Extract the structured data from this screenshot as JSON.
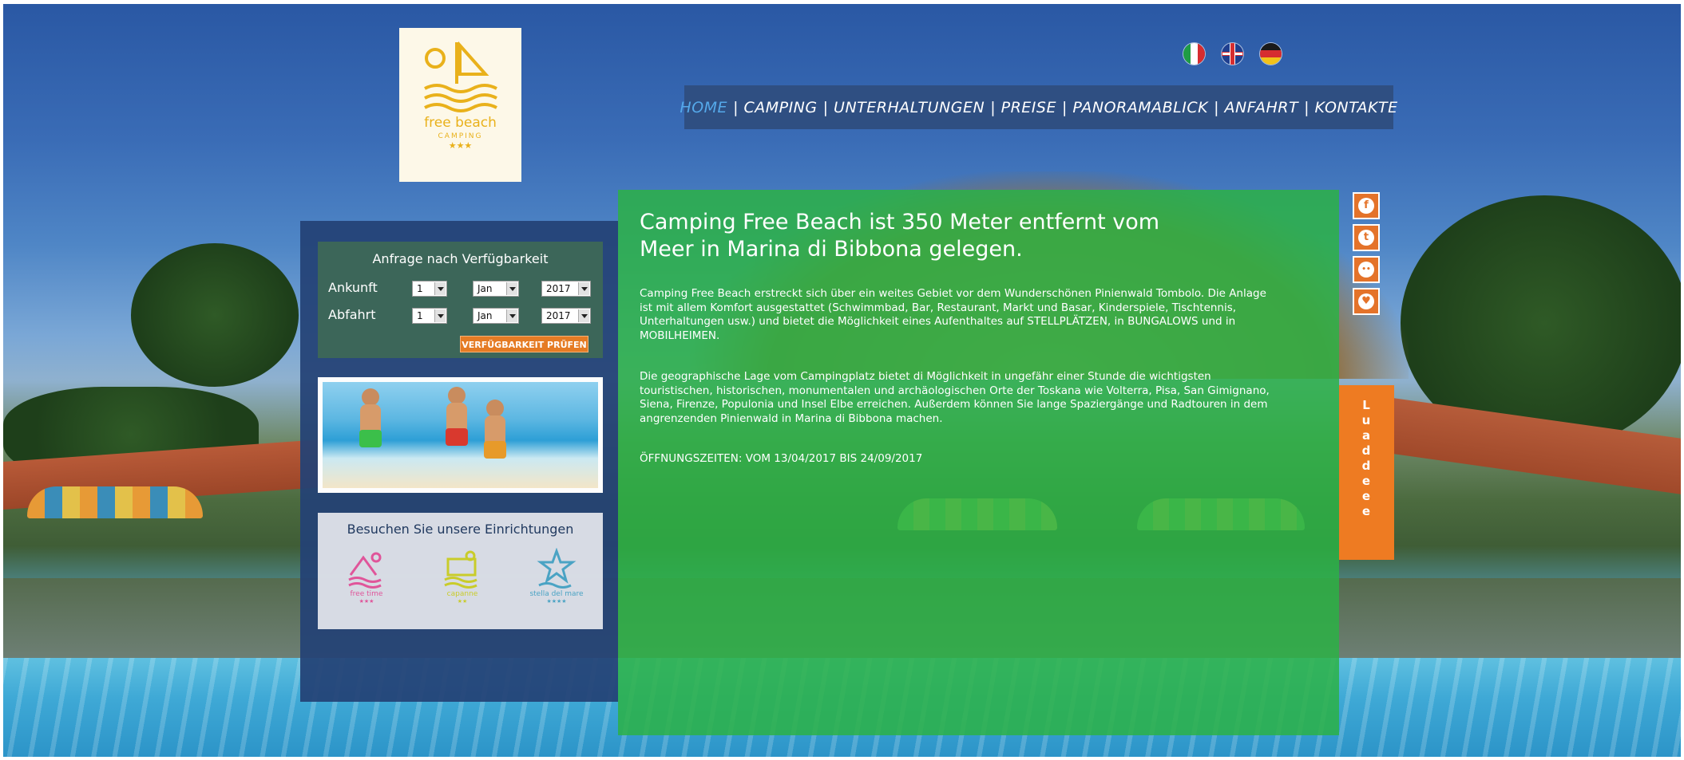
{
  "logo": {
    "brand": "free beach",
    "sub": "CAMPING",
    "stars": "★★★"
  },
  "languages": [
    {
      "name": "Italiano",
      "icon": "flag-it-icon"
    },
    {
      "name": "English",
      "icon": "flag-uk-icon"
    },
    {
      "name": "Deutsch",
      "icon": "flag-de-icon"
    }
  ],
  "nav": {
    "items": [
      "HOME",
      "CAMPING",
      "UNTERHALTUNGEN",
      "PREISE",
      "PANORAMABLICK",
      "ANFAHRT",
      "KONTAKTE"
    ],
    "separator": "|",
    "active": "HOME"
  },
  "availability": {
    "title": "Anfrage nach Verfügbarkeit",
    "arrival_label": "Ankunft",
    "departure_label": "Abfahrt",
    "arrival": {
      "day": "1",
      "month": "Jan",
      "year": "2017"
    },
    "departure": {
      "day": "1",
      "month": "Jan",
      "year": "2017"
    },
    "button": "VERFÜGBARKEIT PRÜFEN"
  },
  "facilities": {
    "title": "Besuchen Sie unsere Einrichtungen",
    "items": [
      {
        "name": "free time",
        "stars": "★★★",
        "color": "#e0559a"
      },
      {
        "name": "capanne",
        "stars": "★★",
        "color": "#c9cc2a"
      },
      {
        "name": "stella del mare",
        "stars": "★★★★",
        "color": "#4aa3c4"
      }
    ]
  },
  "content": {
    "heading_line1": "Camping Free Beach ist 350 Meter entfernt vom",
    "heading_line2": "Meer in Marina di Bibbona gelegen.",
    "paragraph1": "Camping Free Beach erstreckt sich über ein weites Gebiet vor dem Wunderschönen Pinienwald Tombolo. Die Anlage ist mit allem Komfort ausgestattet (Schwimmbad, Bar, Restaurant, Markt und Basar, Kinderspiele, Tischtennis, Unterhaltungen usw.) und bietet die Möglichkeit eines Aufenthaltes auf STELLPLÄTZEN, in BUNGALOWS und in MOBILHEIMEN.",
    "paragraph2": "Die geographische Lage vom Campingplatz bietet di Möglichkeit in ungefähr einer Stunde die wichtigsten touristischen, historischen, monumentalen und archäologischen Orte der Toskana wie Volterra, Pisa, San Gimignano, Siena, Firenze, Populonia und Insel Elbe erreichen. Außerdem können Sie lange Spaziergänge und Radtouren in dem angrenzenden Pinienwald in Marina di Bibbona machen.",
    "opening": "ÖFFNUNGSZEITEN: VOM 13/04/2017 BIS 24/09/2017"
  },
  "social": [
    {
      "icon": "facebook-icon",
      "glyph": "f"
    },
    {
      "icon": "twitter-icon",
      "glyph": "t"
    },
    {
      "icon": "flickr-icon",
      "glyph": "••"
    },
    {
      "icon": "heart-icon",
      "glyph": "♥"
    }
  ],
  "side_tab": {
    "label": "Luaddeee"
  },
  "colors": {
    "nav_bg": "#2f4f82",
    "nav_active": "#55a9ea",
    "content_bg": "#2cb245",
    "accent_orange": "#e57b24",
    "left_panel_bg": "#244275"
  }
}
